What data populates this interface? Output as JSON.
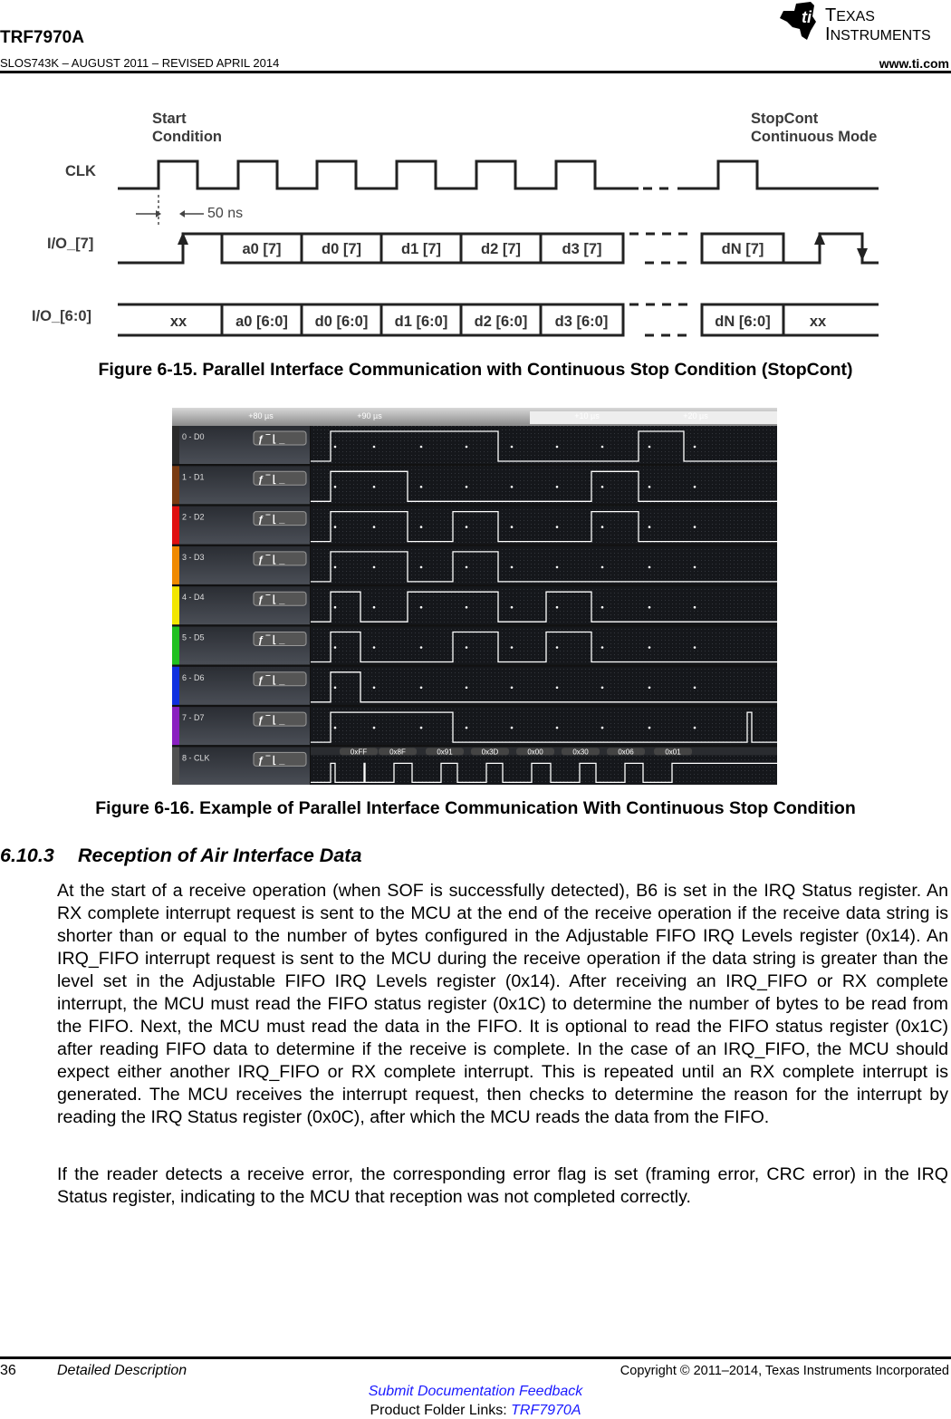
{
  "header": {
    "title": "TRF7970A",
    "doc_id": "SLOS743K – AUGUST 2011 – REVISED APRIL 2014",
    "website": "www.ti.com",
    "logo_text": "TEXAS INSTRUMENTS"
  },
  "figure_15": {
    "label_start": [
      "Start",
      "Condition"
    ],
    "label_stop": [
      "StopCont",
      "Continuous Mode"
    ],
    "signals": [
      "CLK",
      "I/O_[7]",
      "I/O_[6:0]"
    ],
    "timing_note": "50 ns",
    "io7_cells": [
      "a0 [7]",
      "d0 [7]",
      "d1 [7]",
      "d2 [7]",
      "d3 [7]",
      "dN [7]"
    ],
    "io60_cells": [
      "xx",
      "a0 [6:0]",
      "d0 [6:0]",
      "d1 [6:0]",
      "d2 [6:0]",
      "d3 [6:0]",
      "dN [6:0]",
      "xx"
    ],
    "caption": "Figure 6-15. Parallel Interface Communication with Continuous Stop Condition (StopCont)"
  },
  "figure_16": {
    "time_ticks": [
      "+80 µs",
      "+90 µs",
      "+10 µs",
      "+20 µs"
    ],
    "channels": [
      {
        "label": "0 - D0",
        "color": "#2a2a2a"
      },
      {
        "label": "1 - D1",
        "color": "#7a3b12"
      },
      {
        "label": "2 - D2",
        "color": "#e01010"
      },
      {
        "label": "3 - D3",
        "color": "#f08a00"
      },
      {
        "label": "4 - D4",
        "color": "#f2e600"
      },
      {
        "label": "5 - D5",
        "color": "#20c020"
      },
      {
        "label": "6 - D6",
        "color": "#1030e0"
      },
      {
        "label": "7 - D7",
        "color": "#8a20c0"
      },
      {
        "label": "8 - CLK",
        "color": "#505050"
      }
    ],
    "bytes": [
      "0xFF",
      "0x8F",
      "0x91",
      "0x3D",
      "0x00",
      "0x30",
      "0x06",
      "0x01"
    ],
    "caption": "Figure 6-16. Example of Parallel Interface Communication With Continuous Stop Condition"
  },
  "section": {
    "number": "6.10.3",
    "title": "Reception of Air Interface Data",
    "paragraphs": [
      "At the start of a receive operation (when SOF is successfully detected), B6 is set in the IRQ Status register. An RX complete interrupt request is sent to the MCU at the end of the receive operation if the receive data string is shorter than or equal to the number of bytes configured in the Adjustable FIFO IRQ Levels register (0x14). An IRQ_FIFO interrupt request is sent to the MCU during the receive operation if the data string is greater than the level set in the Adjustable FIFO IRQ Levels register (0x14). After receiving an IRQ_FIFO or RX complete interrupt, the MCU must read the FIFO status register (0x1C) to determine the number of bytes to be read from the FIFO. Next, the MCU must read the data in the FIFO. It is optional to read the FIFO status register (0x1C) after reading FIFO data to determine if the receive is complete. In the case of an IRQ_FIFO, the MCU should expect either another IRQ_FIFO or RX complete interrupt. This is repeated until an RX complete interrupt is generated. The MCU receives the interrupt request, then checks to determine the reason for the interrupt by reading the IRQ Status register (0x0C), after which the MCU reads the data from the FIFO.",
      "If the reader detects a receive error, the corresponding error flag is set (framing error, CRC error) in the IRQ Status register, indicating to the MCU that reception was not completed correctly."
    ]
  },
  "footer": {
    "page_number": "36",
    "section_name": "Detailed Description",
    "copyright": "Copyright © 2011–2014, Texas Instruments Incorporated",
    "feedback_link": "Submit Documentation Feedback",
    "product_folder_label": "Product Folder Links: ",
    "product_link": "TRF7970A"
  }
}
